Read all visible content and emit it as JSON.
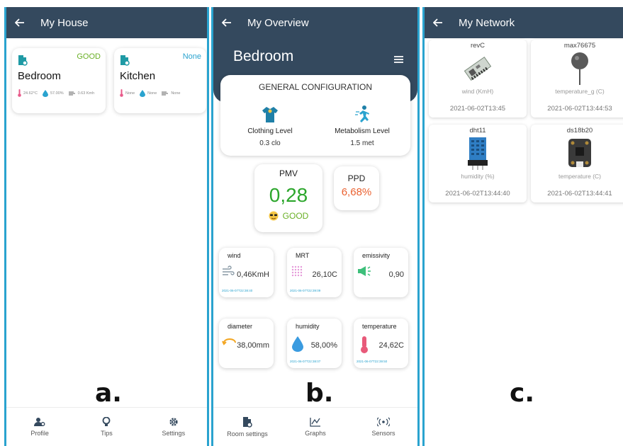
{
  "panel_a": {
    "title": "My House",
    "letter": "a.",
    "rooms": [
      {
        "name": "Bedroom",
        "status": "GOOD",
        "status_color": "#6ab026",
        "temp": "24.62°C",
        "humidity": "57.00%",
        "wind": "0.63 Kmh"
      },
      {
        "name": "Kitchen",
        "status": "None",
        "status_color": "#2aa3cf",
        "temp": "None",
        "humidity": "None",
        "wind": "None"
      }
    ],
    "nav": [
      {
        "label": "Profile",
        "icon": "profile-icon"
      },
      {
        "label": "Tips",
        "icon": "bulb-icon"
      },
      {
        "label": "Settings",
        "icon": "gear-icon"
      }
    ]
  },
  "panel_b": {
    "title": "My Overview",
    "letter": "b.",
    "room": "Bedroom",
    "config": {
      "title": "GENERAL CONFIGURATION",
      "clothing_label": "Clothing Level",
      "clothing_value": "0.3 clo",
      "metabolism_label": "Metabolism Level",
      "metabolism_value": "1.5 met"
    },
    "pmv": {
      "label": "PMV",
      "value": "0,28",
      "status": "GOOD"
    },
    "ppd": {
      "label": "PPD",
      "value": "6,68%"
    },
    "sensors": [
      {
        "name": "wind",
        "value": "0,46KmH",
        "time": "2021-06-07T22:38:40",
        "icon": "wind-icon"
      },
      {
        "name": "MRT",
        "value": "26,10C",
        "time": "2021-06-07T22:39:09",
        "icon": "radiant-icon"
      },
      {
        "name": "emissivity",
        "value": "0,90",
        "icon": "megaphone-icon"
      },
      {
        "name": "diameter",
        "value": "38,00mm",
        "icon": "diameter-icon"
      },
      {
        "name": "humidity",
        "value": "58,00%",
        "time": "2021-06-07T22:38:07",
        "icon": "drop-icon"
      },
      {
        "name": "temperature",
        "value": "24,62C",
        "time": "2021-06-07T22:39:50",
        "icon": "thermometer-icon"
      }
    ],
    "nav": [
      {
        "label": "Room settings",
        "icon": "room-settings-icon"
      },
      {
        "label": "Graphs",
        "icon": "graph-icon"
      },
      {
        "label": "Sensors",
        "icon": "sensors-icon"
      }
    ]
  },
  "panel_c": {
    "title": "My Network",
    "letter": "c.",
    "devices": [
      {
        "name": "revC",
        "type": "wind (KmH)",
        "time": "2021-06-02T13:45"
      },
      {
        "name": "max76675",
        "type": "temperature_g (C)",
        "time": "2021-06-02T13:44:53"
      },
      {
        "name": "dht11",
        "type": "humidity (%)",
        "time": "2021-06-02T13:44:40"
      },
      {
        "name": "ds18b20",
        "type": "temperature (C)",
        "time": "2021-06-02T13:44:41"
      }
    ]
  }
}
